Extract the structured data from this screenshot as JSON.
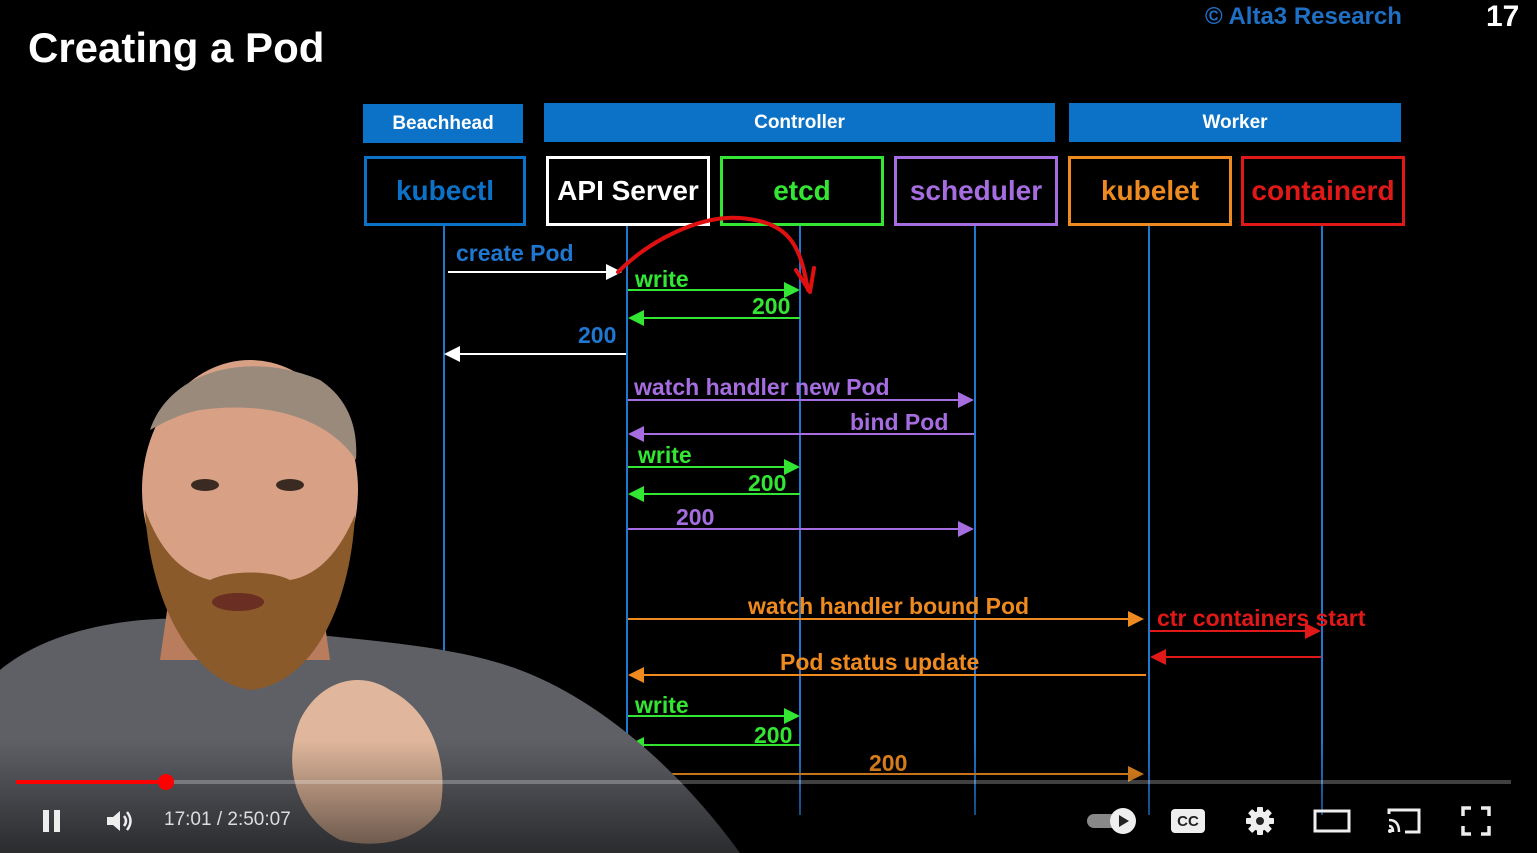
{
  "slide": {
    "title": "Creating a Pod",
    "copyright": "© Alta3 Research",
    "number": "17"
  },
  "groups": [
    {
      "label": "Beachhead"
    },
    {
      "label": "Controller"
    },
    {
      "label": "Worker"
    }
  ],
  "actors": [
    {
      "label": "kubectl",
      "color": "#0b72c7"
    },
    {
      "label": "API Server",
      "color": "#ffffff"
    },
    {
      "label": "etcd",
      "color": "#33e633"
    },
    {
      "label": "scheduler",
      "color": "#a56de0"
    },
    {
      "label": "kubelet",
      "color": "#ee8a1f"
    },
    {
      "label": "containerd",
      "color": "#e01818"
    }
  ],
  "messages": [
    {
      "label": "create Pod",
      "color": "#1f77d0"
    },
    {
      "label": "write",
      "color": "#33e633"
    },
    {
      "label": "200",
      "color": "#33e633"
    },
    {
      "label": "200",
      "color": "#1f77d0"
    },
    {
      "label": "watch handler new Pod",
      "color": "#a56de0"
    },
    {
      "label": "bind Pod",
      "color": "#a56de0"
    },
    {
      "label": "write",
      "color": "#33e633"
    },
    {
      "label": "200",
      "color": "#33e633"
    },
    {
      "label": "200",
      "color": "#a56de0"
    },
    {
      "label": "watch handler bound Pod",
      "color": "#ee8a1f"
    },
    {
      "label": "ctr containers start",
      "color": "#e01818"
    },
    {
      "label": "Pod status update",
      "color": "#ee8a1f"
    },
    {
      "label": "write",
      "color": "#33e633"
    },
    {
      "label": "200",
      "color": "#33e633"
    },
    {
      "label": "200",
      "color": "#ee8a1f"
    }
  ],
  "player": {
    "time_display": "17:01 / 2:50:07",
    "progress_fraction": 0.1,
    "accent": "#ff0000",
    "icons": [
      "pause-icon",
      "volume-icon",
      "autoplay-toggle-icon",
      "captions-icon",
      "settings-icon",
      "theater-mode-icon",
      "cast-icon",
      "fullscreen-icon"
    ],
    "captions_label": "CC"
  }
}
